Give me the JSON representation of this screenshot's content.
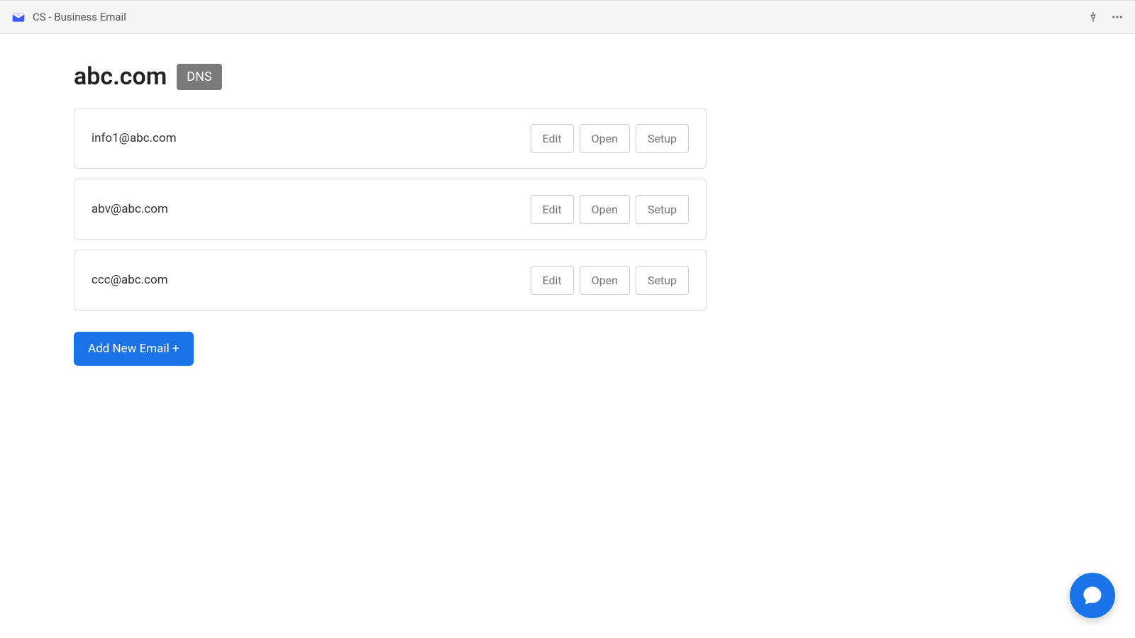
{
  "header": {
    "title": "CS - Business Email"
  },
  "domain": {
    "name": "abc.com",
    "dns_badge": "DNS"
  },
  "emails": [
    {
      "address": "info1@abc.com"
    },
    {
      "address": "abv@abc.com"
    },
    {
      "address": "ccc@abc.com"
    }
  ],
  "buttons": {
    "edit": "Edit",
    "open": "Open",
    "setup": "Setup",
    "add_new": "Add New Email +"
  }
}
